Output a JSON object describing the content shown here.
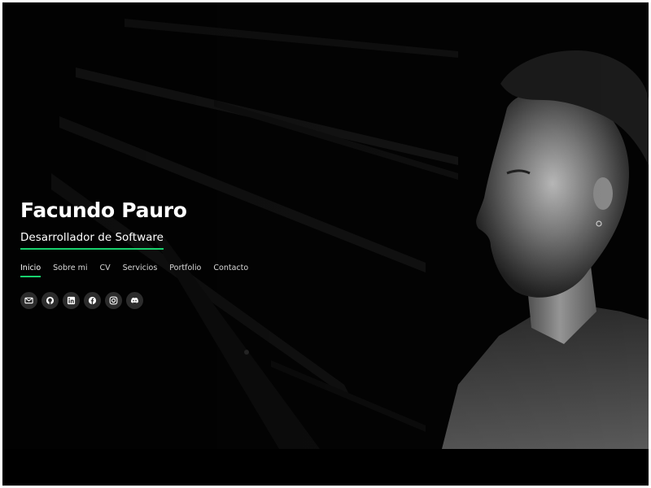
{
  "hero": {
    "name": "Facundo Pauro",
    "subtitle": "Desarrollador de Software"
  },
  "nav": [
    {
      "label": "Inicio",
      "active": true
    },
    {
      "label": "Sobre mi",
      "active": false
    },
    {
      "label": "CV",
      "active": false
    },
    {
      "label": "Servicios",
      "active": false
    },
    {
      "label": "Portfolio",
      "active": false
    },
    {
      "label": "Contacto",
      "active": false
    }
  ],
  "social": [
    {
      "icon": "mail-icon"
    },
    {
      "icon": "github-icon"
    },
    {
      "icon": "linkedin-icon"
    },
    {
      "icon": "facebook-icon"
    },
    {
      "icon": "instagram-icon"
    },
    {
      "icon": "discord-icon"
    }
  ],
  "colors": {
    "accent": "#18d26e",
    "background": "#000000",
    "icon_bg": "#2c2c2c"
  }
}
